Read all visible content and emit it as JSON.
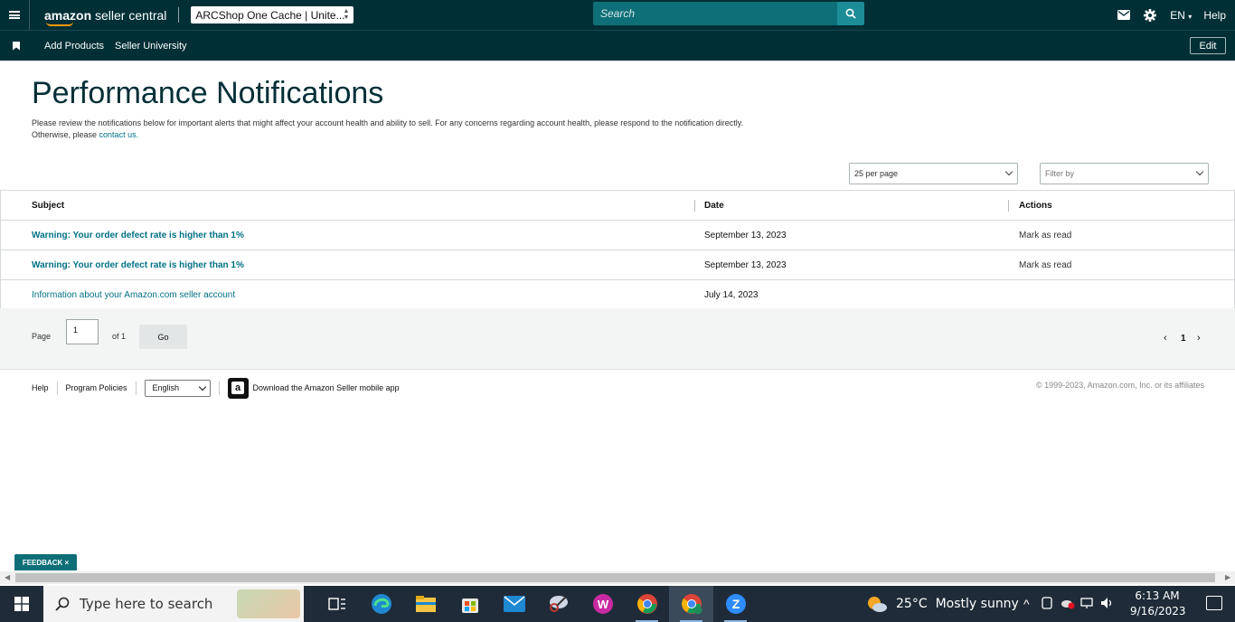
{
  "header": {
    "logo_text_bold": "amazon",
    "logo_text_rest": " seller central",
    "store_selector_value": "ARCShop One Cache | Unite...",
    "search_placeholder": "Search",
    "language": "EN",
    "help_label": "Help"
  },
  "subnav": {
    "items": [
      {
        "label": "Add Products"
      },
      {
        "label": "Seller University"
      }
    ],
    "edit_label": "Edit"
  },
  "page": {
    "title": "Performance Notifications",
    "intro_text": "Please review the notifications below for important alerts that might affect your account health and ability to sell. For any concerns regarding account health, please respond to the notification directly.",
    "intro_text2": "Otherwise, please ",
    "contact_link": "contact us.",
    "per_page_value": "25 per page",
    "filter_placeholder": "Filter by"
  },
  "table": {
    "headers": [
      "Subject",
      "Date",
      "Actions"
    ],
    "rows": [
      {
        "subject": "Warning: Your order defect rate is higher than 1%",
        "date": "September 13, 2023",
        "action": "Mark as read",
        "bold": true
      },
      {
        "subject": "Warning: Your order defect rate is higher than 1%",
        "date": "September 13, 2023",
        "action": "Mark as read",
        "bold": true
      },
      {
        "subject": "Information about your Amazon.com seller account",
        "date": "July 14, 2023",
        "action": "",
        "bold": false
      }
    ]
  },
  "pagination": {
    "page_label": "Page",
    "current_page": "1",
    "of_label": "of 1",
    "go_label": "Go",
    "nav_page": "1"
  },
  "footer": {
    "help": "Help",
    "program_policies": "Program Policies",
    "language_value": "English",
    "app_download": "Download the Amazon Seller mobile app",
    "copyright": "© 1999-2023, Amazon.com, Inc. or its affiliates"
  },
  "feedback_label": "FEEDBACK",
  "taskbar": {
    "search_placeholder": "Type here to search",
    "weather_temp": "25°C",
    "weather_desc": "Mostly sunny",
    "time": "6:13 AM",
    "date": "9/16/2023"
  },
  "colors": {
    "header_bg": "#002f36",
    "accent_teal": "#0e6f78",
    "link": "#007185",
    "logo_orange": "#ff9900"
  }
}
